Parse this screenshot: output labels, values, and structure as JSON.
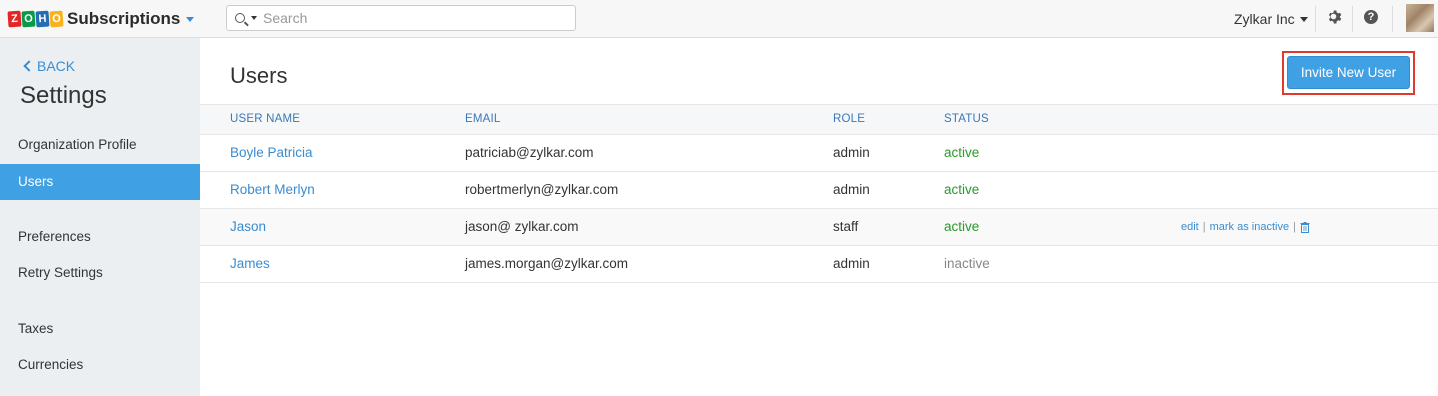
{
  "header": {
    "logo_letters": [
      "Z",
      "O",
      "H",
      "O"
    ],
    "logo_colors": [
      "#e42527",
      "#089949",
      "#226db4",
      "#f9b21d"
    ],
    "app_name": "Subscriptions",
    "search_placeholder": "Search",
    "org_name": "Zylkar Inc"
  },
  "sidebar": {
    "back_label": "BACK",
    "title": "Settings",
    "items": [
      {
        "label": "Organization Profile",
        "active": false
      },
      {
        "label": "Users",
        "active": true
      },
      {
        "label": "Preferences",
        "active": false
      },
      {
        "label": "Retry Settings",
        "active": false
      },
      {
        "label": "Taxes",
        "active": false
      },
      {
        "label": "Currencies",
        "active": false
      }
    ]
  },
  "main": {
    "title": "Users",
    "invite_button": "Invite New User",
    "columns": [
      "USER NAME",
      "EMAIL",
      "ROLE",
      "STATUS"
    ],
    "rows": [
      {
        "name": "Boyle Patricia",
        "email": "patriciab@zylkar.com",
        "role": "admin",
        "status": "active"
      },
      {
        "name": "Robert Merlyn",
        "email": "robertmerlyn@zylkar.com",
        "role": "admin",
        "status": "active"
      },
      {
        "name": "Jason",
        "email": "jason@ zylkar.com",
        "role": "staff",
        "status": "active"
      },
      {
        "name": "James",
        "email": "james.morgan@zylkar.com",
        "role": "admin",
        "status": "inactive"
      }
    ],
    "row_actions": {
      "edit": "edit",
      "mark_inactive": "mark as inactive",
      "sep": "|"
    }
  },
  "colors": {
    "accent": "#3fa0e3",
    "link": "#3a8ccf",
    "active_status": "#2a9a2a",
    "highlight_outline": "#e03a2f"
  }
}
